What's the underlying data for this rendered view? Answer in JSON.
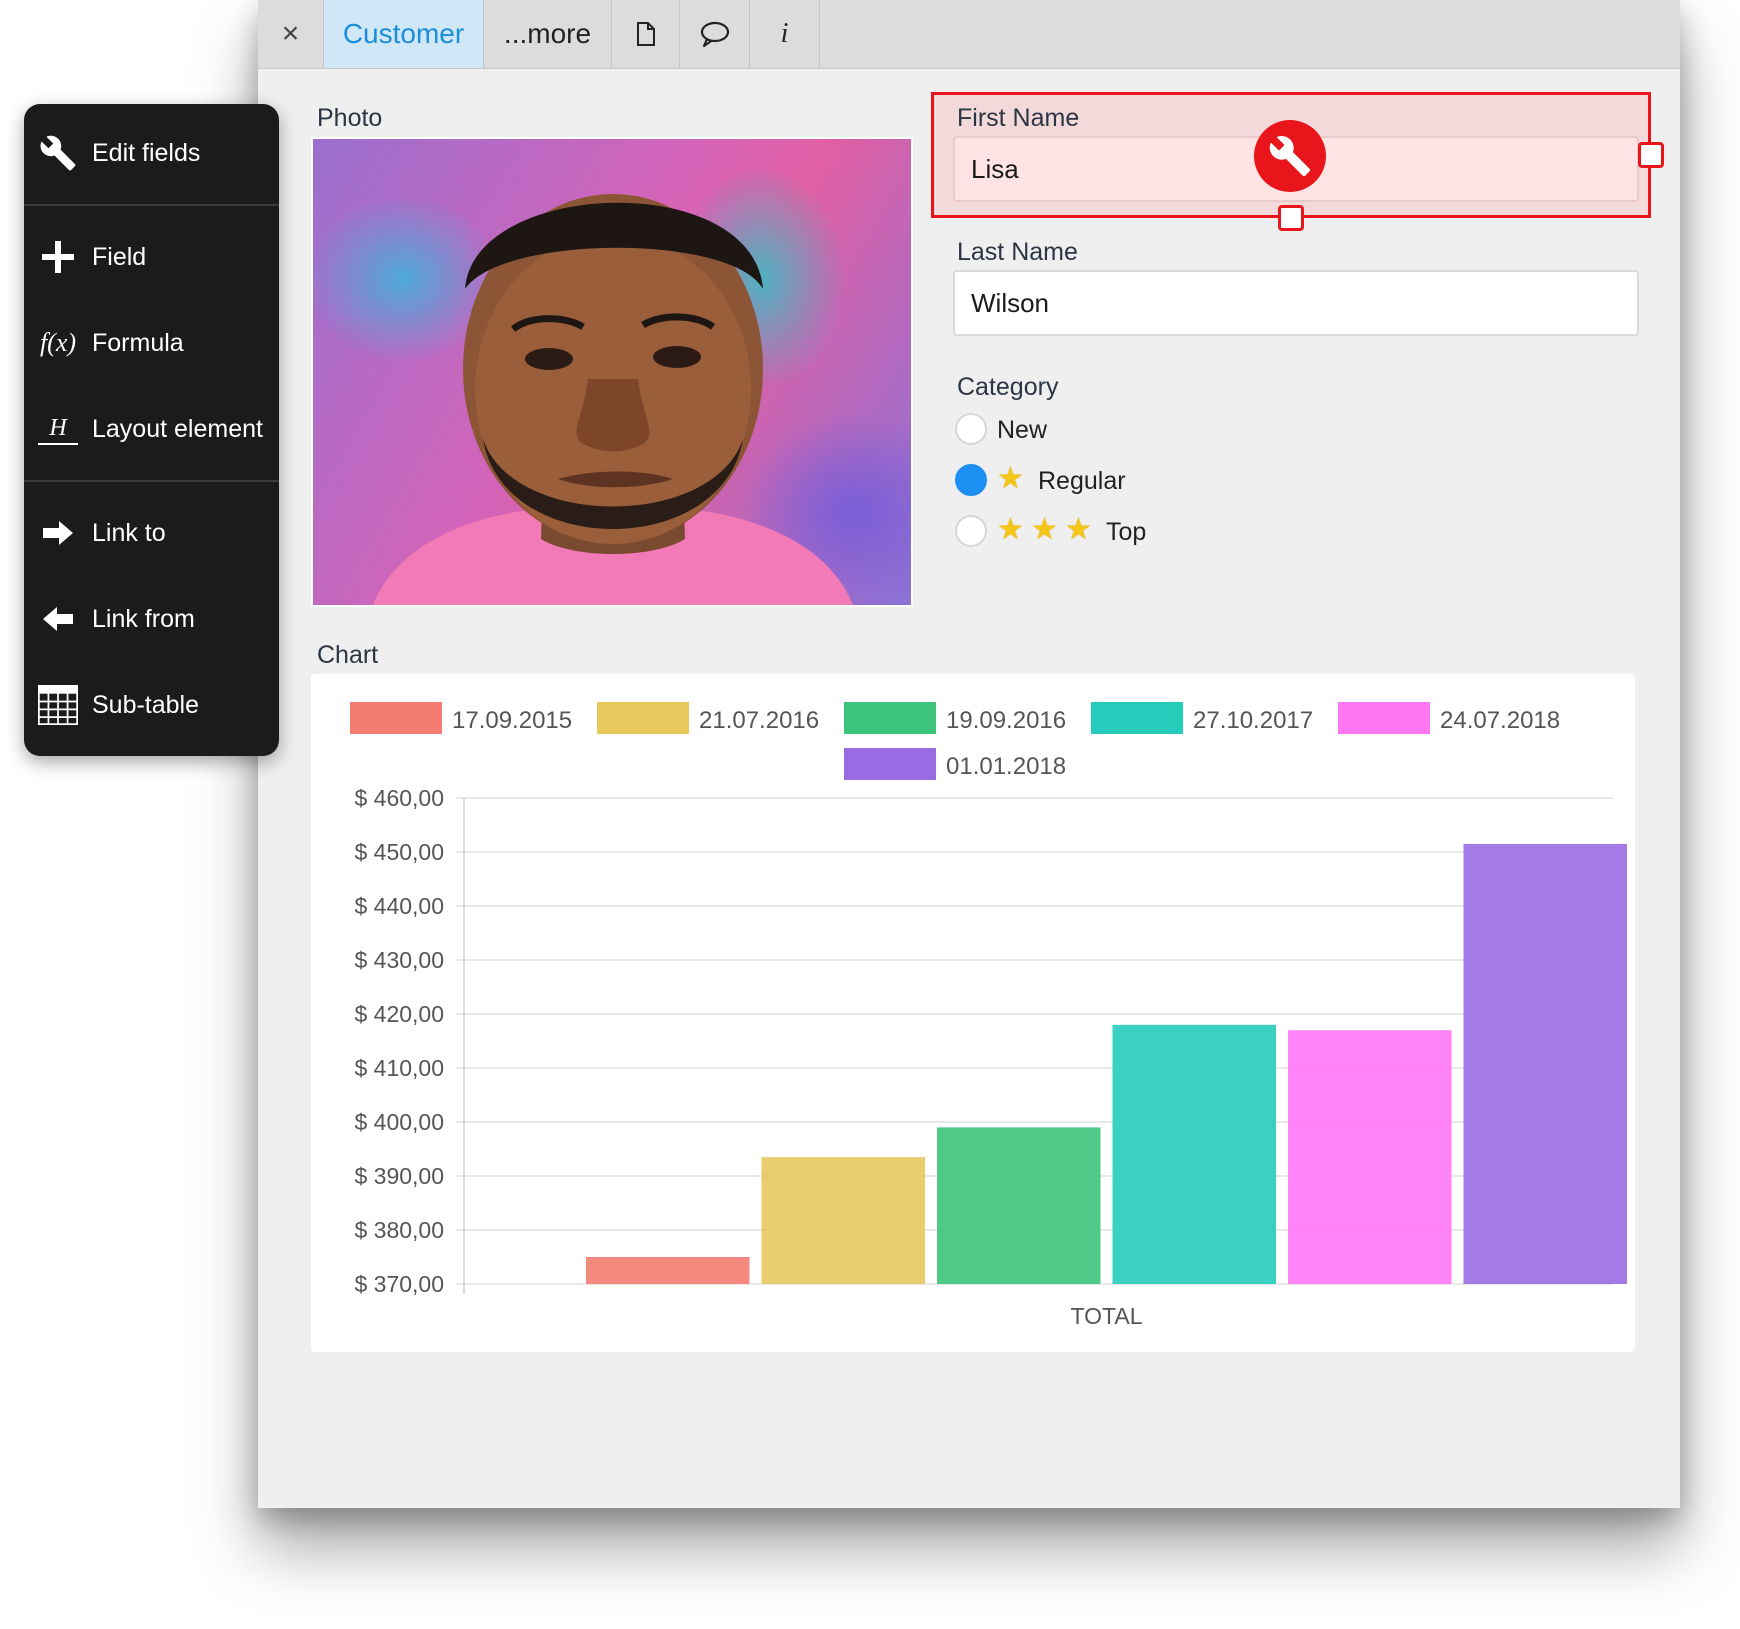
{
  "tabs": {
    "close": "×",
    "customer": "Customer",
    "more": "...more",
    "info": "i"
  },
  "form": {
    "photo_label": "Photo",
    "first_name_label": "First Name",
    "first_name_value": "Lisa",
    "last_name_label": "Last Name",
    "last_name_value": "Wilson",
    "category_label": "Category",
    "category_options": [
      {
        "label": "New",
        "stars": 0,
        "selected": false
      },
      {
        "label": "Regular",
        "stars": 1,
        "selected": true
      },
      {
        "label": "Top",
        "stars": 3,
        "selected": false
      }
    ],
    "chart_label": "Chart"
  },
  "palette": {
    "items": [
      {
        "label": "Edit fields",
        "icon": "wrench-icon"
      },
      {
        "label": "Field",
        "icon": "plus-icon"
      },
      {
        "label": "Formula",
        "icon": "formula-icon",
        "glyph": "f(x)"
      },
      {
        "label": "Layout element",
        "icon": "heading-icon",
        "glyph": "H"
      },
      {
        "label": "Link to",
        "icon": "arrow-right-icon"
      },
      {
        "label": "Link from",
        "icon": "arrow-left-icon"
      },
      {
        "label": "Sub-table",
        "icon": "grid-icon"
      }
    ]
  },
  "colors": {
    "accent_blue": "#1a8ed8",
    "selection_red": "#e8161a",
    "radio_selected": "#1e8ff2"
  },
  "chart_data": {
    "type": "bar",
    "categories": [
      "TOTAL"
    ],
    "xlabel": "",
    "ylabel": "",
    "ylim": [
      370,
      460
    ],
    "yticks": [
      370,
      380,
      390,
      400,
      410,
      420,
      430,
      440,
      450,
      460
    ],
    "ytick_labels": [
      "$ 370,00",
      "$ 380,00",
      "$ 390,00",
      "$ 400,00",
      "$ 410,00",
      "$ 420,00",
      "$ 430,00",
      "$ 440,00",
      "$ 450,00",
      "$ 460,00"
    ],
    "legend_position": "top",
    "grid": true,
    "series": [
      {
        "name": "17.09.2015",
        "values": [
          375
        ],
        "color": "#f47c72"
      },
      {
        "name": "21.07.2016",
        "values": [
          393.5
        ],
        "color": "#e8c95e"
      },
      {
        "name": "19.09.2016",
        "values": [
          399
        ],
        "color": "#3cc47c"
      },
      {
        "name": "27.10.2017",
        "values": [
          418
        ],
        "color": "#25cbbb"
      },
      {
        "name": "24.07.2018",
        "values": [
          417
        ],
        "color": "#ff77f5"
      },
      {
        "name": "01.01.2018",
        "values": [
          451.5
        ],
        "color": "#9a6be3"
      }
    ]
  }
}
